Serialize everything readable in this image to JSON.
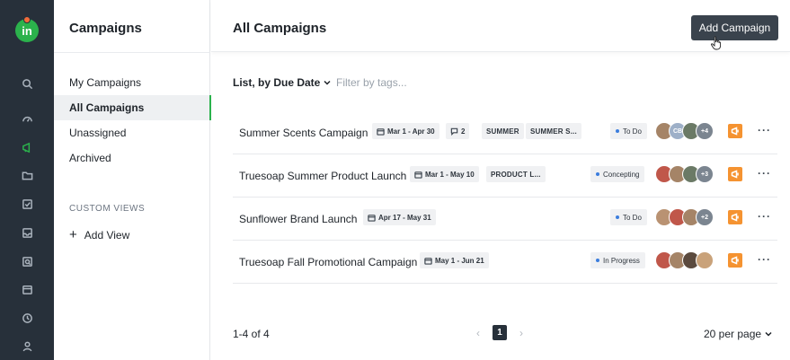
{
  "app": {
    "logo_text": "in"
  },
  "sidebar": {
    "title": "Campaigns",
    "items": [
      {
        "label": "My Campaigns"
      },
      {
        "label": "All Campaigns"
      },
      {
        "label": "Unassigned"
      },
      {
        "label": "Archived"
      }
    ],
    "section_label": "CUSTOM VIEWS",
    "add_view_label": "Add View",
    "add_view_glyph": "+"
  },
  "header": {
    "title": "All Campaigns",
    "add_button_label": "Add Campaign"
  },
  "toolbar": {
    "list_by_label": "List, by Due Date",
    "filter_placeholder": "Filter by tags..."
  },
  "campaigns": [
    {
      "name": "Summer Scents Campaign",
      "dates": "Mar 1 - Apr 30",
      "comments": "2",
      "tags": [
        "SUMMER",
        "SUMMER S..."
      ],
      "status": "To Do",
      "avatar_initials": [
        "",
        "CB",
        "",
        "+4"
      ]
    },
    {
      "name": "Truesoap Summer Product Launch",
      "dates": "Mar 1 - May 10",
      "tags": [
        "PRODUCT L..."
      ],
      "status": "Concepting",
      "avatar_initials": [
        "",
        "",
        "",
        "+3"
      ]
    },
    {
      "name": "Sunflower Brand Launch",
      "dates": "Apr 17 - May 31",
      "tags": [],
      "status": "To Do",
      "avatar_initials": [
        "",
        "",
        "",
        "+2"
      ]
    },
    {
      "name": "Truesoap Fall Promotional Campaign",
      "dates": "May 1 - Jun 21",
      "tags": [],
      "status": "In Progress",
      "avatar_initials": [
        "",
        "",
        "",
        ""
      ]
    }
  ],
  "footer": {
    "count_label": "1-4 of 4",
    "current_page": "1",
    "per_page_label": "20 per page",
    "prev_glyph": "‹",
    "next_glyph": "›"
  },
  "glyphs": {
    "more": "···",
    "chevron_down": "⌄"
  },
  "colors": {
    "accent": "#2bb24c",
    "rail": "#27303a",
    "button": "#3a434d",
    "megaphone": "#f59331",
    "status_dot": "#3b7ddd"
  }
}
